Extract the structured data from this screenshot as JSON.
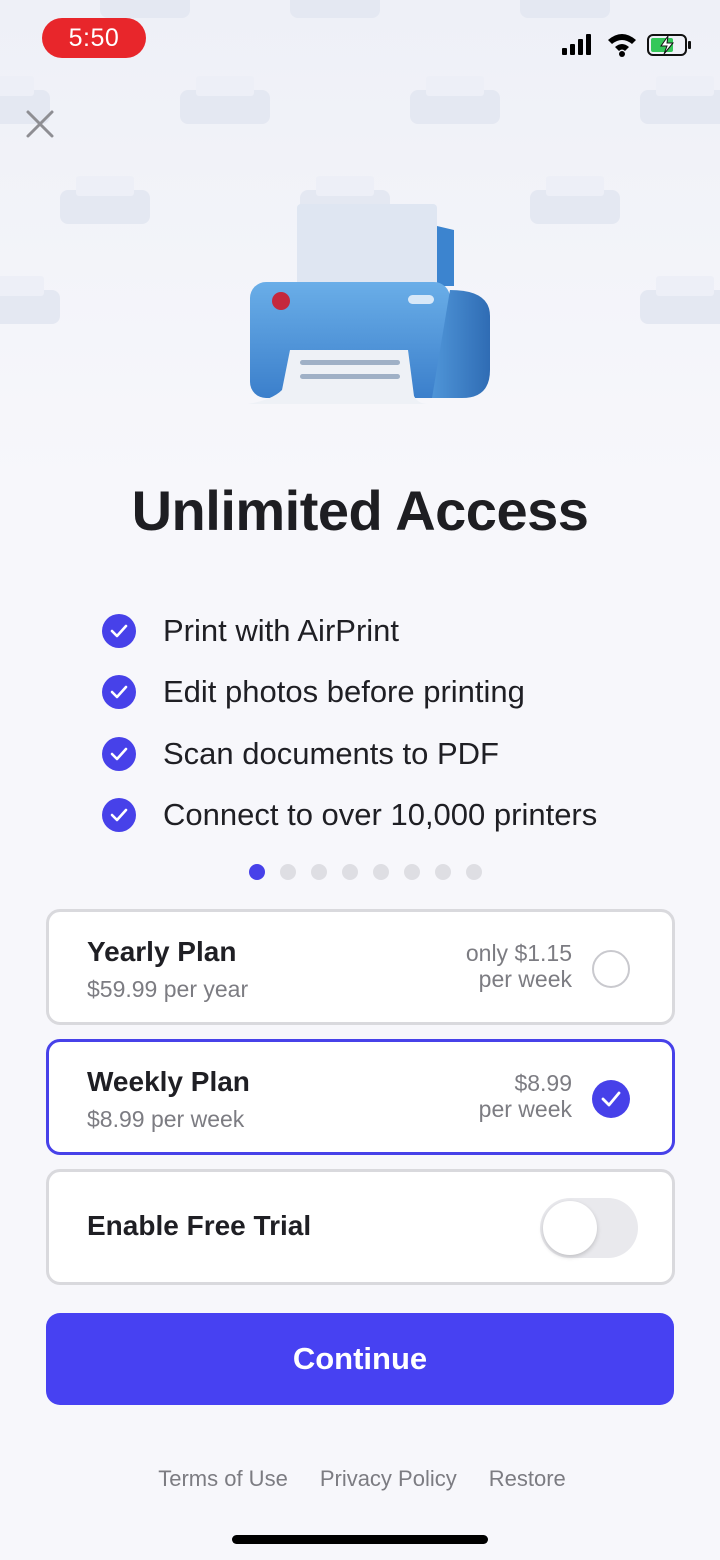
{
  "status_bar": {
    "time": "5:50",
    "icons": [
      "cellular-signal-icon",
      "wifi-icon",
      "battery-charging-icon"
    ],
    "time_pill_color": "#e8262b"
  },
  "header": {
    "close_icon": "close-icon",
    "hero_icon": "printer-icon"
  },
  "title": "Unlimited Access",
  "features": [
    {
      "label": "Print with AirPrint",
      "icon": "check-circle-icon"
    },
    {
      "label": "Edit photos before printing",
      "icon": "check-circle-icon"
    },
    {
      "label": "Scan documents to PDF",
      "icon": "check-circle-icon"
    },
    {
      "label": "Connect to over 10,000 printers",
      "icon": "check-circle-icon"
    }
  ],
  "carousel": {
    "page_count": 8,
    "active_index": 0
  },
  "plans": [
    {
      "name": "Yearly Plan",
      "price": "$59.99 per year",
      "note_line1": "only $1.15",
      "note_line2": "per week",
      "selected": false
    },
    {
      "name": "Weekly Plan",
      "price": "$8.99 per week",
      "note_line1": "$8.99",
      "note_line2": "per week",
      "selected": true
    }
  ],
  "free_trial": {
    "label": "Enable Free Trial",
    "enabled": false
  },
  "continue_label": "Continue",
  "footer": {
    "terms": "Terms of Use",
    "privacy": "Privacy Policy",
    "restore": "Restore"
  },
  "colors": {
    "accent": "#4741e9",
    "button": "#4741f2",
    "muted_text": "#7c7c82",
    "border": "#d9d9dd"
  }
}
